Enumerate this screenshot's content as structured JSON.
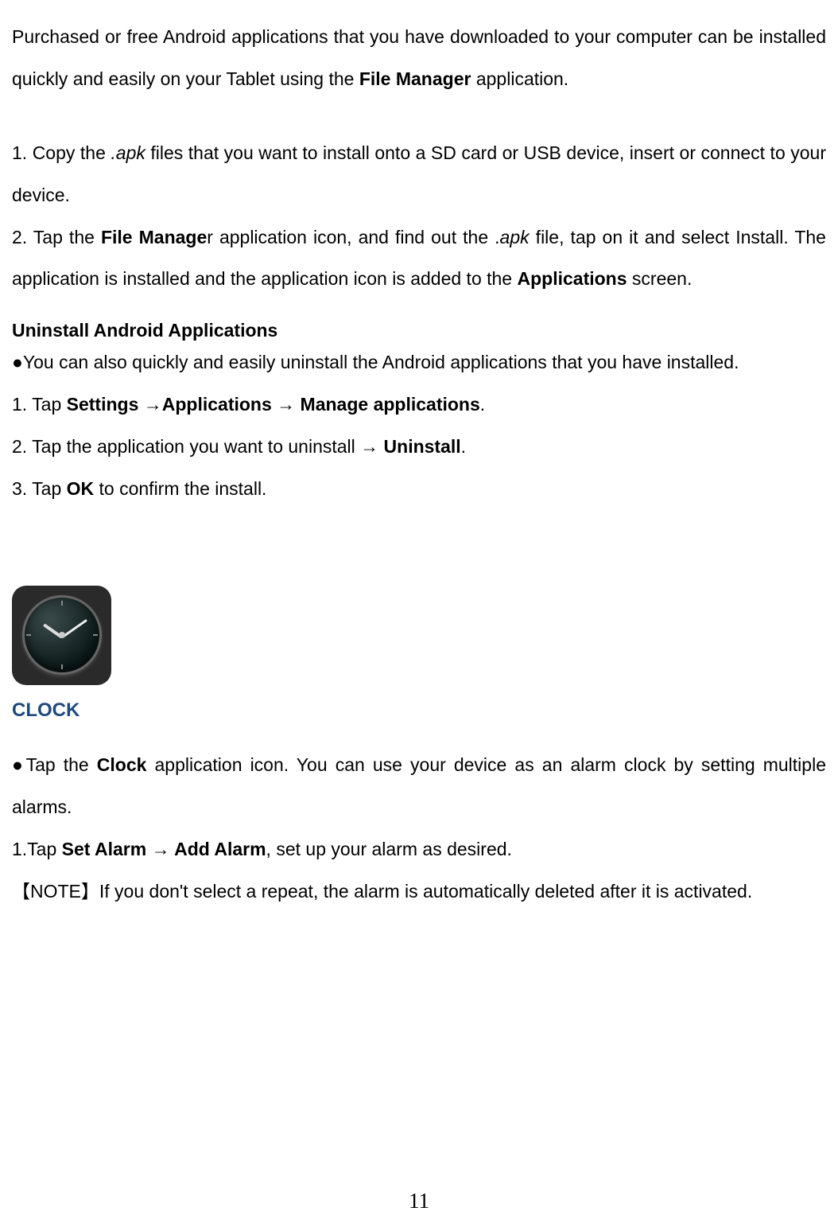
{
  "intro": {
    "text_before_bold": "Purchased or free Android applications that you have downloaded to your computer can be installed quickly and easily on your Tablet using the ",
    "bold_text": "File Manager",
    "text_after_bold": " application."
  },
  "install_steps": {
    "step1_prefix": "1. Copy the ",
    "step1_italic": ".apk",
    "step1_suffix": " files that you want to install onto a SD card or USB device, insert or connect to your device.",
    "step2_prefix": "2. Tap the ",
    "step2_bold": "File Manage",
    "step2_mid1": "r application icon, and find out the .",
    "step2_italic": "apk",
    "step2_mid2": " file, tap on it and select Install. The application is installed and the application icon is added to the ",
    "step2_bold2": "Applications",
    "step2_suffix": " screen."
  },
  "uninstall": {
    "heading": "Uninstall Android Applications",
    "bullet": "●You can also quickly and easily uninstall the Android applications that you have installed.",
    "step1_prefix": "1. Tap ",
    "step1_bold": "Settings →Applications → Manage applications",
    "step1_suffix": ".",
    "step2_prefix": "2. Tap the application you want to uninstall → ",
    "step2_bold": "Uninstall",
    "step2_suffix": ".",
    "step3_prefix": "3. Tap ",
    "step3_bold": "OK",
    "step3_suffix": " to confirm the install."
  },
  "clock": {
    "title": "CLOCK",
    "bullet_prefix": "●Tap the ",
    "bullet_bold": "Clock",
    "bullet_suffix": " application icon. You can use your device as an alarm clock by setting multiple alarms.",
    "step1_prefix": "1.Tap ",
    "step1_bold": "Set Alarm  →  Add Alarm",
    "step1_suffix": ", set up your alarm as desired.",
    "note": "【NOTE】If you don't select a repeat, the alarm is automatically deleted after it is activated."
  },
  "page_number": "11"
}
